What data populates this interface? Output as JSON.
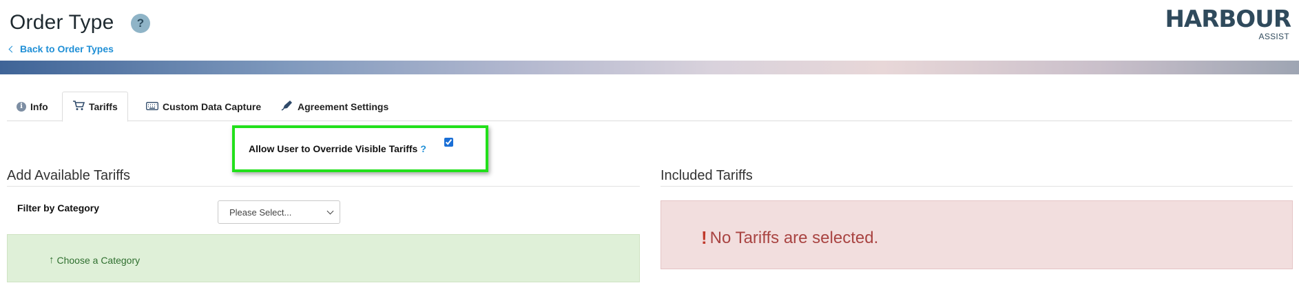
{
  "header": {
    "title": "Order Type",
    "help_symbol": "?",
    "back_link": "Back to Order Types"
  },
  "logo": {
    "brand": "HARBOUR",
    "sub": "ASSIST"
  },
  "tabs": [
    {
      "label": "Info",
      "icon": "info-icon",
      "active": false
    },
    {
      "label": "Tariffs",
      "icon": "cart-icon",
      "active": true
    },
    {
      "label": "Custom Data Capture",
      "icon": "keyboard-icon",
      "active": false
    },
    {
      "label": "Agreement Settings",
      "icon": "pen-icon",
      "active": false
    }
  ],
  "override": {
    "label": "Allow User to Override Visible Tariffs",
    "help": "?",
    "checked": true
  },
  "available": {
    "heading": "Add Available Tariffs",
    "filter_label": "Filter by Category",
    "filter_selected": "Please Select...",
    "choose_hint": "Choose a Category"
  },
  "included": {
    "heading": "Included Tariffs",
    "empty_symbol": "!",
    "empty_message": "No Tariffs are selected."
  },
  "colors": {
    "highlight": "#22e01b",
    "link": "#1f8fd6",
    "success_bg": "#dff0d8",
    "danger_bg": "#f2dede",
    "danger_text": "#a94442"
  }
}
